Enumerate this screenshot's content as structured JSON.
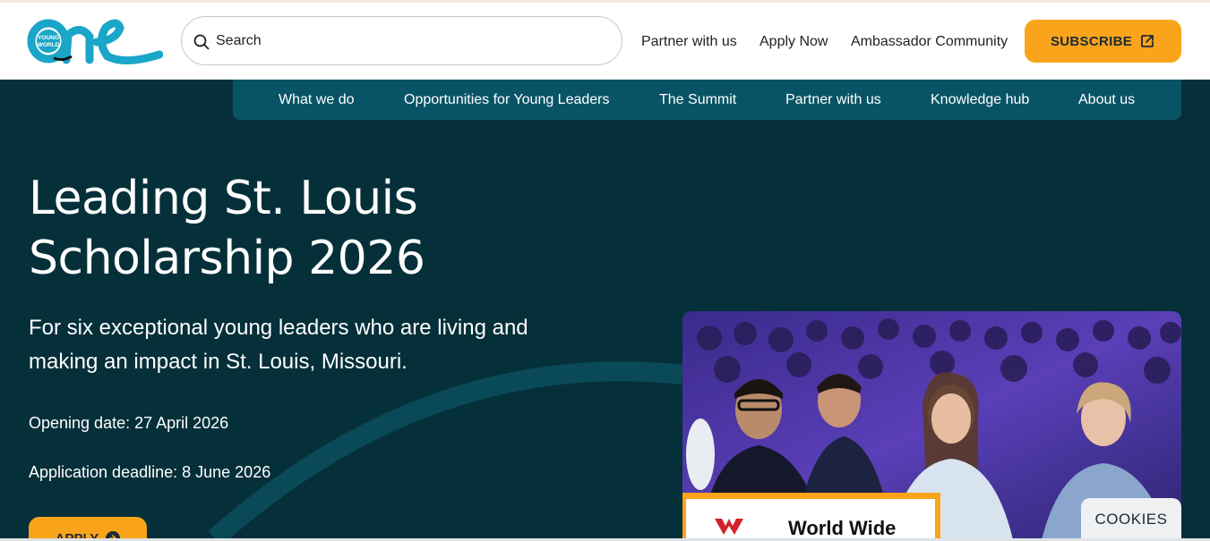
{
  "header": {
    "logo_text": "YOUNG WORLD",
    "logo_word": "one",
    "search": {
      "placeholder": "Search",
      "icon": "search-icon"
    },
    "links": [
      "Partner with us",
      "Apply Now",
      "Ambassador Community"
    ],
    "subscribe_label": "SUBSCRIBE",
    "subscribe_icon": "external-link-icon"
  },
  "nav": {
    "items": [
      "What we do",
      "Opportunities for Young Leaders",
      "The Summit",
      "Partner with us",
      "Knowledge hub",
      "About us"
    ]
  },
  "hero": {
    "title_line1": "Leading St. Louis",
    "title_line2": "Scholarship 2026",
    "lede": "For six exceptional young leaders who are living and making an impact in St. Louis, Missouri.",
    "opening_date": "Opening date: 27 April 2026",
    "deadline": "Application deadline: 8 June 2026",
    "apply_label": "APPLY",
    "apply_icon": "arrow-right-circle-icon",
    "photo_sign_text": "World Wide"
  },
  "cookies_label": "COOKIES",
  "colors": {
    "brand_teal": "#1aa6c8",
    "hero_bg": "#05303a",
    "nav_bg": "#085466",
    "accent_orange": "#f9a41a"
  }
}
